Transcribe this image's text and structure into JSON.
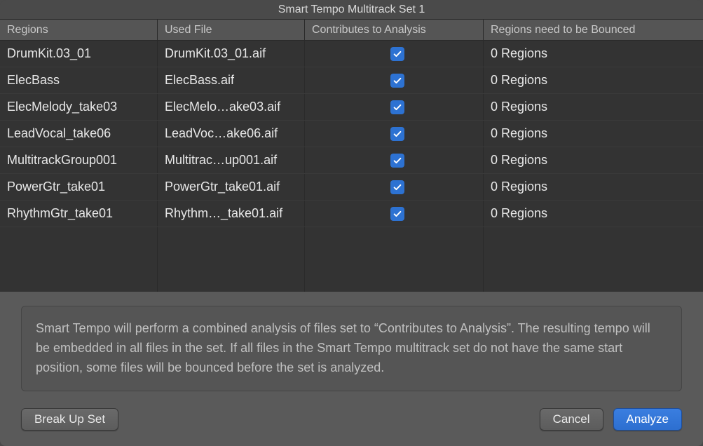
{
  "window": {
    "title": "Smart Tempo Multitrack Set 1"
  },
  "columns": {
    "regions": "Regions",
    "usedFile": "Used File",
    "contributes": "Contributes to Analysis",
    "bounced": "Regions need to be Bounced"
  },
  "rows": [
    {
      "region": "DrumKit.03_01",
      "file": "DrumKit.03_01.aif",
      "checked": true,
      "bounced": "0 Regions"
    },
    {
      "region": "ElecBass",
      "file": "ElecBass.aif",
      "checked": true,
      "bounced": "0 Regions"
    },
    {
      "region": "ElecMelody_take03",
      "file": "ElecMelo…ake03.aif",
      "checked": true,
      "bounced": "0 Regions"
    },
    {
      "region": "LeadVocal_take06",
      "file": "LeadVoc…ake06.aif",
      "checked": true,
      "bounced": "0 Regions"
    },
    {
      "region": "MultitrackGroup001",
      "file": "Multitrac…up001.aif",
      "checked": true,
      "bounced": "0 Regions"
    },
    {
      "region": "PowerGtr_take01",
      "file": "PowerGtr_take01.aif",
      "checked": true,
      "bounced": "0 Regions"
    },
    {
      "region": "RhythmGtr_take01",
      "file": "Rhythm…_take01.aif",
      "checked": true,
      "bounced": "0 Regions"
    }
  ],
  "info": "Smart Tempo will perform a combined analysis of files set to “Contributes to Analysis”. The resulting tempo will be embedded in all files in the set. If all files in the Smart Tempo multitrack set do not have the same start position, some files will be bounced before the set is analyzed.",
  "buttons": {
    "breakUp": "Break Up Set",
    "cancel": "Cancel",
    "analyze": "Analyze"
  }
}
